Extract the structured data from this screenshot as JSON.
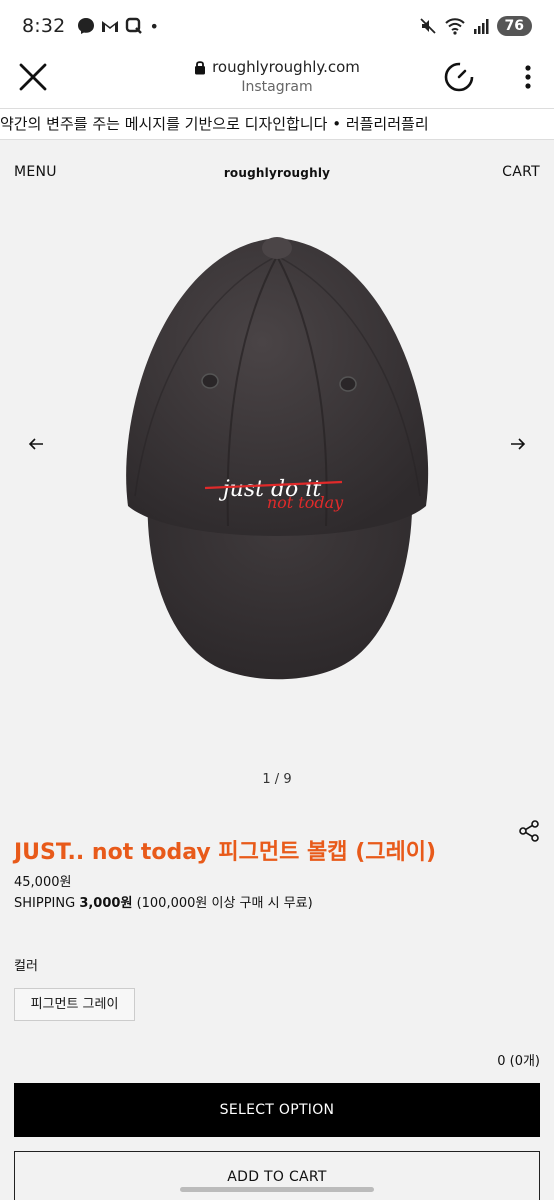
{
  "status_bar": {
    "time": "8:32",
    "battery": "76"
  },
  "browser": {
    "url": "roughlyroughly.com",
    "subtitle": "Instagram"
  },
  "marquee": {
    "text": "약간의 변주를 주는 메시지를 기반으로 디자인합니다 • 러플리러플리"
  },
  "header": {
    "menu_label": "MENU",
    "logo_text": "roughlyroughly",
    "cart_label": "CART"
  },
  "gallery": {
    "indicator": "1 / 9",
    "embroidery_line1": "just do it",
    "embroidery_line2": "not today",
    "cap_color": "#3c3739",
    "accent_color": "#e02a2a"
  },
  "product": {
    "title": "JUST.. not today 피그먼트 볼캡 (그레이)",
    "price": "45,000원",
    "shipping_label": "SHIPPING",
    "shipping_amount": "3,000원",
    "shipping_note": "(100,000원 이상 구매 시 무료)",
    "title_color": "#e85a1a"
  },
  "options": {
    "label": "컬러",
    "selected_value": "피그먼트 그레이"
  },
  "quantity_total": "0 (0개)",
  "actions": {
    "select_option_label": "SELECT OPTION",
    "add_to_cart_label": "ADD TO CART"
  }
}
